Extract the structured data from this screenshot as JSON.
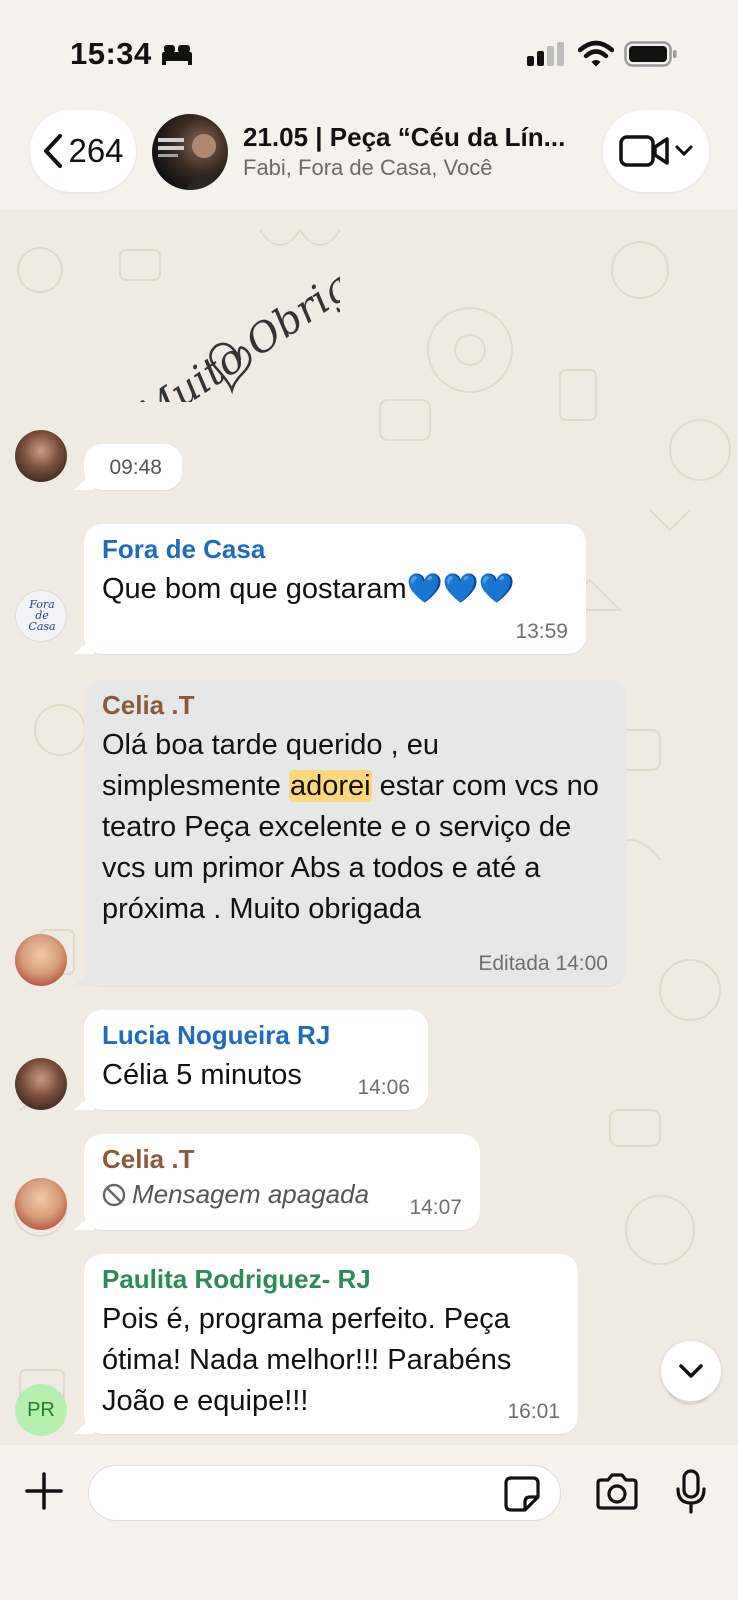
{
  "status_bar": {
    "time": "15:34"
  },
  "header": {
    "back_count": "264",
    "group_title": "21.05 | Peça “Céu da Lín...",
    "group_members": "Fabi, Fora de Casa, Você"
  },
  "sticker": {
    "text_line1": "Muito Obrigada"
  },
  "messages": [
    {
      "time": "09:48"
    },
    {
      "sender": "Fora de Casa",
      "text": "Que bom que gostaram💙💙💙",
      "time": "13:59"
    },
    {
      "sender": "Celia .T",
      "text_before": "Olá boa tarde querido , eu simplesmente ",
      "highlight": "adorei",
      "text_after": " estar com vcs no teatro Peça excelente e o serviço de vcs um primor Abs a todos e até a próxima . Muito obrigada",
      "edited_label": "Editada",
      "time": "14:00"
    },
    {
      "sender": "Lucia Nogueira RJ",
      "text": "Célia 5 minutos",
      "time": "14:06"
    },
    {
      "sender": "Celia .T",
      "text": "Mensagem apagada",
      "time": "14:07"
    },
    {
      "sender": "Paulita Rodriguez- RJ",
      "text": "Pois é, programa perfeito. Peça ótima! Nada melhor!!! Parabéns João e equipe!!!",
      "time": "16:01"
    }
  ],
  "avatars": {
    "pr_initials": "PR"
  },
  "input": {
    "value": "",
    "placeholder": ""
  },
  "colors": {
    "sender_blue": "#1f6bbf",
    "sender_brown": "#8a5a3b",
    "sender_green": "#2e8b57",
    "highlight": "#fdd77e"
  }
}
